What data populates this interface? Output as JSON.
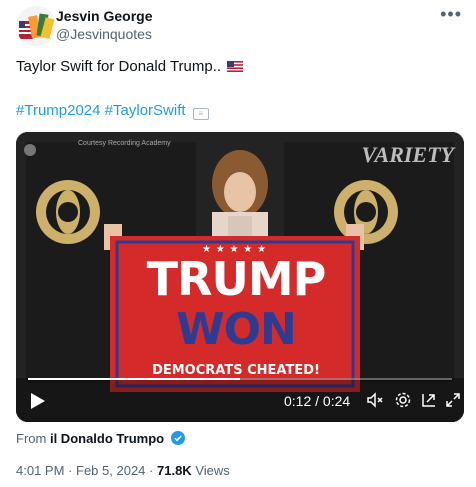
{
  "author": {
    "name": "Jesvin George",
    "handle": "@Jesvinquotes"
  },
  "tweet": {
    "text": "Taylor Swift for Donald Trump..",
    "hashtag_1": "#Trump2024",
    "hashtag_2": "#TaylorSwift"
  },
  "video": {
    "watermark": "VARIETY",
    "credit": "Courtesy Recording Academy",
    "banner": {
      "stars": "★ ★ ★ ★ ★",
      "line1": "TRUMP",
      "line2": "WON",
      "line3": "DEMOCRATS CHEATED!"
    },
    "time": "0:12 / 0:24",
    "progress": 0.5
  },
  "source": {
    "prefix": "From",
    "name": "il Donaldo Trumpo"
  },
  "meta": {
    "time": "4:01 PM",
    "date": "Feb 5, 2024",
    "views": "71.8K",
    "views_label": "Views"
  },
  "colors": {
    "link": "#1d9bf0",
    "secondary": "#536471",
    "banner_red": "#d42a2a",
    "banner_blue": "#2c3c93"
  }
}
